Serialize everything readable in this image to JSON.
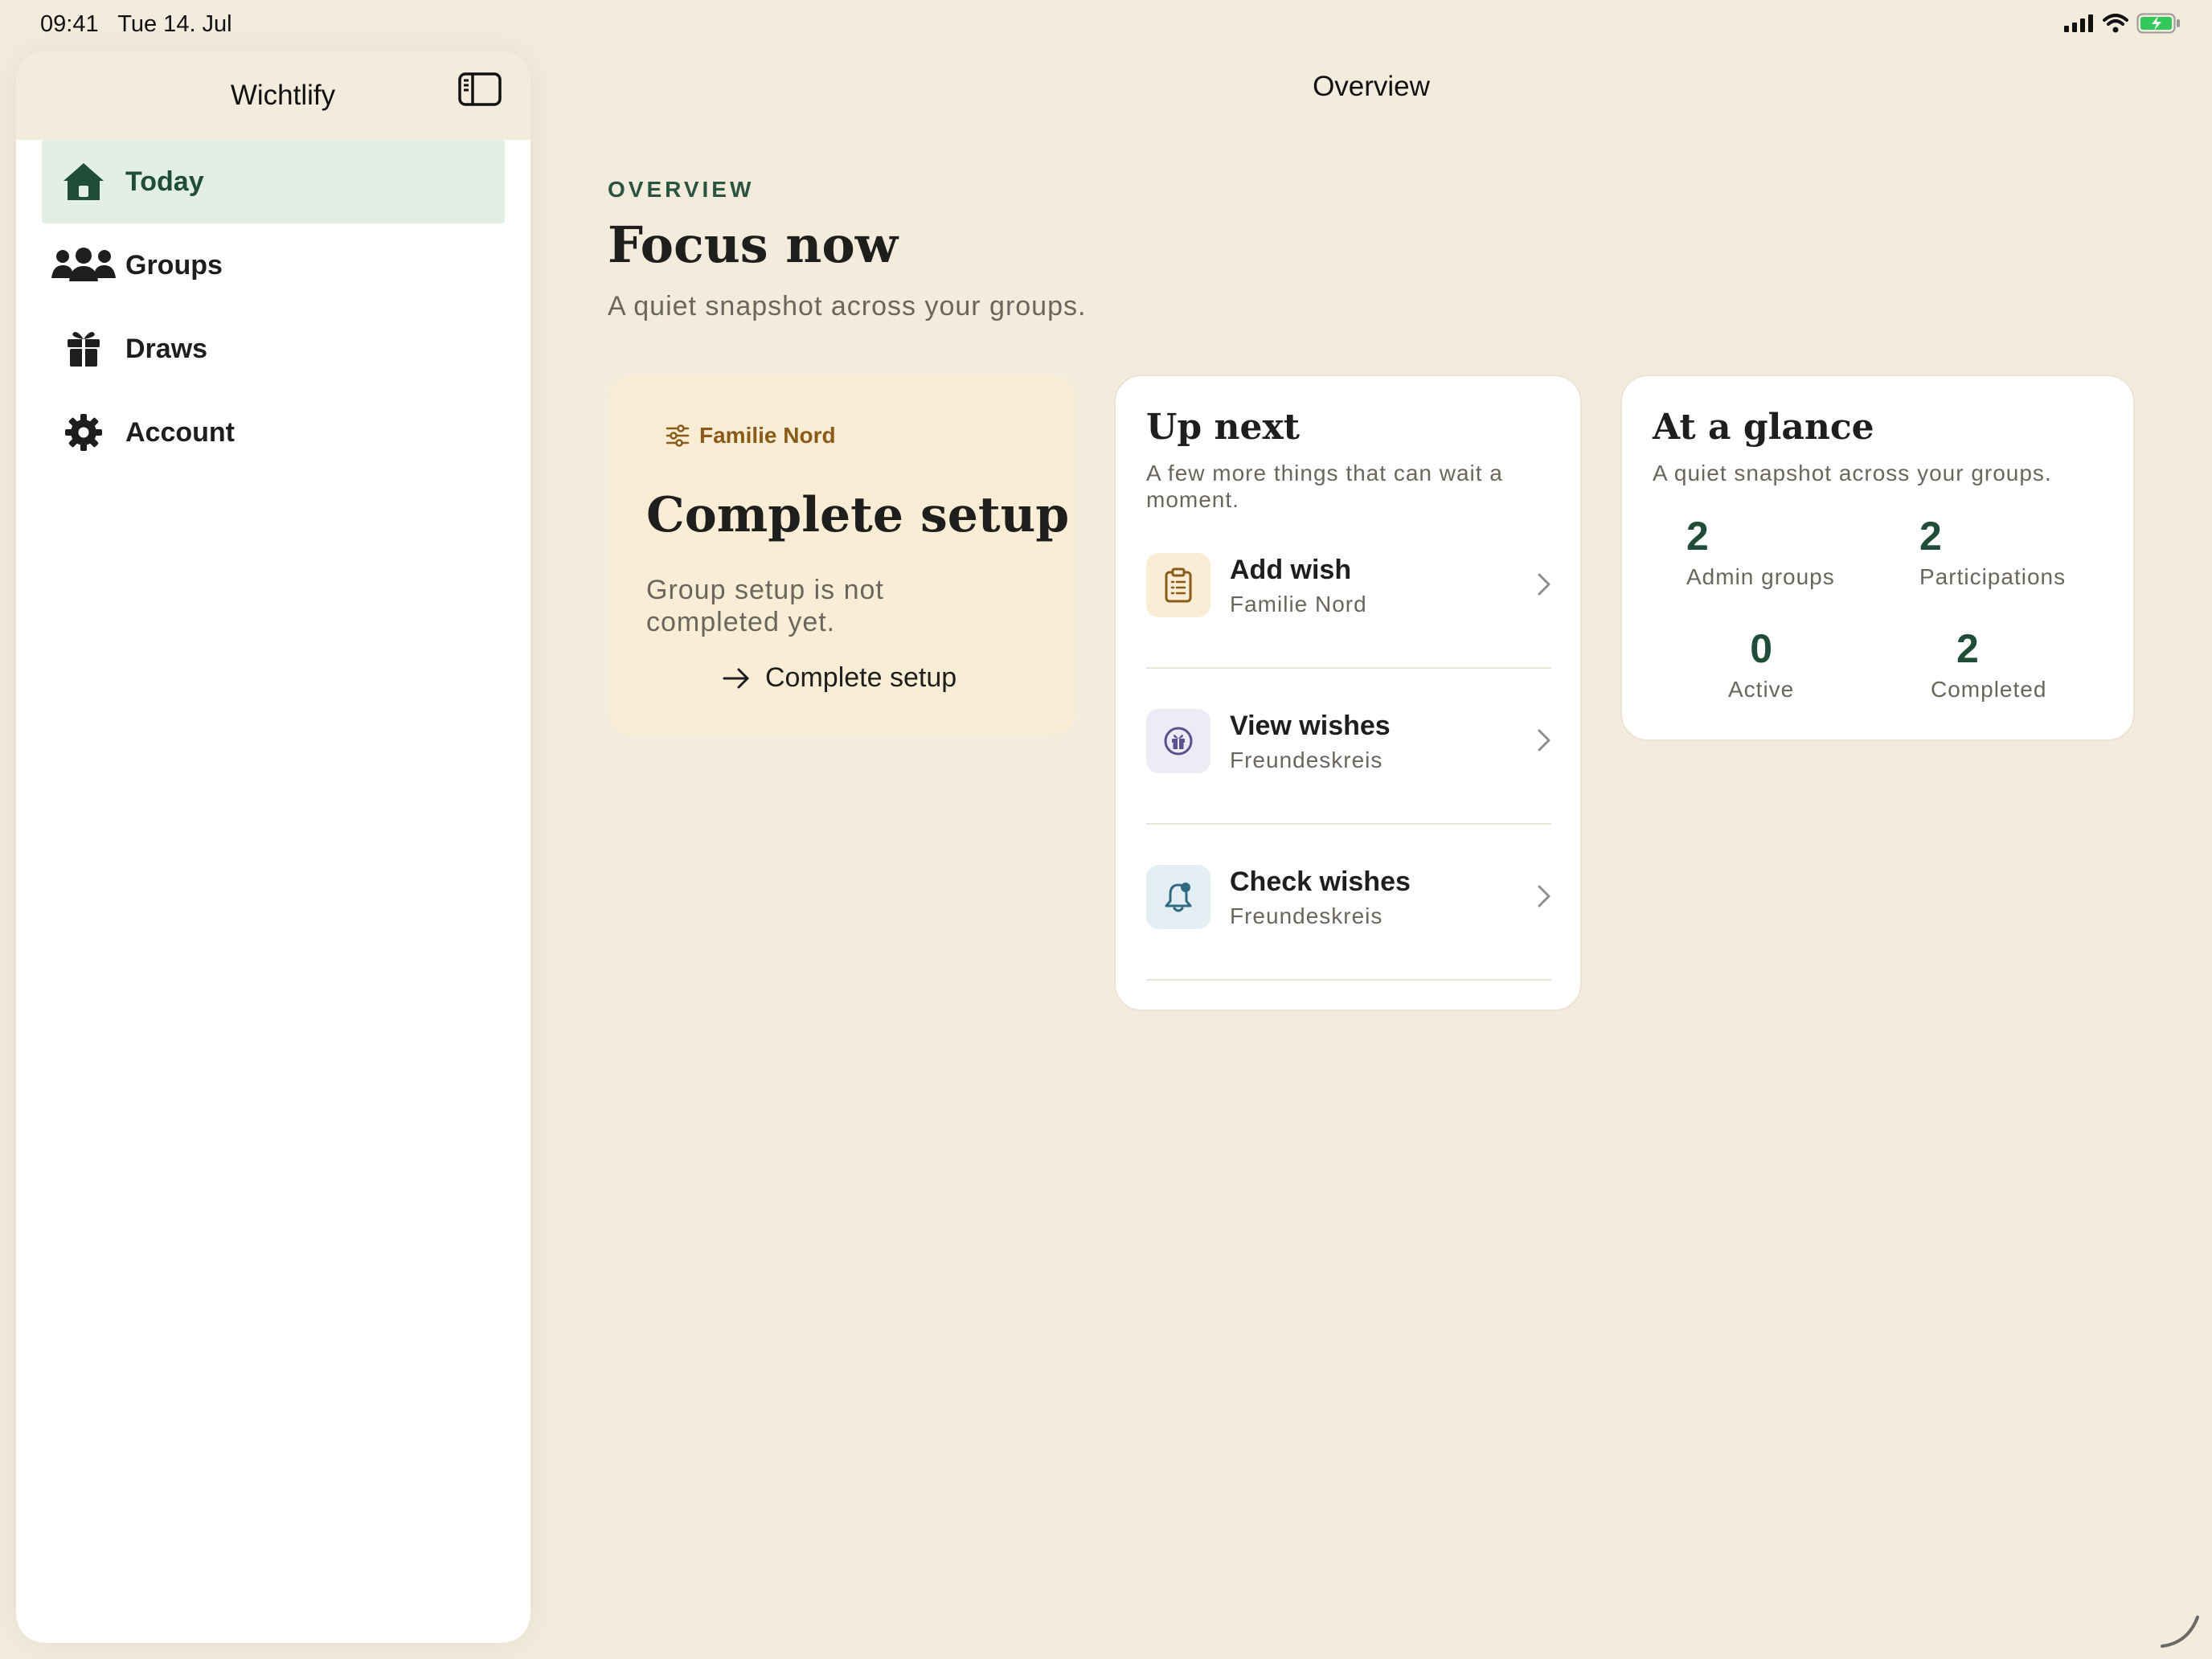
{
  "status_bar": {
    "time": "09:41",
    "date": "Tue 14. Jul",
    "icons": [
      "cellular-signal-icon",
      "wifi-icon",
      "battery-charging-icon"
    ]
  },
  "sidebar": {
    "title": "Wichtlify",
    "toggle_icon": "sidebar-toggle-icon",
    "items": [
      {
        "label": "Today",
        "icon": "house-icon",
        "active": true
      },
      {
        "label": "Groups",
        "icon": "people-icon",
        "active": false
      },
      {
        "label": "Draws",
        "icon": "gift-icon",
        "active": false
      },
      {
        "label": "Account",
        "icon": "gear-icon",
        "active": false
      }
    ]
  },
  "main": {
    "nav_title": "Overview",
    "eyebrow": "OVERVIEW",
    "heading": "Focus now",
    "subheading": "A quiet snapshot across your groups."
  },
  "focus_card": {
    "group": "Familie Nord",
    "title": "Complete setup",
    "description": "Group setup is not completed yet.",
    "action_label": "Complete setup"
  },
  "up_next": {
    "title": "Up next",
    "subtitle": "A few more things that can wait a moment.",
    "items": [
      {
        "title": "Add wish",
        "group": "Familie Nord",
        "icon": "clipboard-icon"
      },
      {
        "title": "View wishes",
        "group": "Freundeskreis",
        "icon": "gift-circle-icon"
      },
      {
        "title": "Check wishes",
        "group": "Freundeskreis",
        "icon": "bell-badge-icon"
      }
    ]
  },
  "glance": {
    "title": "At a glance",
    "subtitle": "A quiet snapshot across your groups.",
    "stats": [
      {
        "value": "2",
        "label": "Admin groups"
      },
      {
        "value": "2",
        "label": "Participations"
      },
      {
        "value": "0",
        "label": "Active"
      },
      {
        "value": "2",
        "label": "Completed"
      }
    ]
  },
  "colors": {
    "background": "#f3ecdd",
    "accent_green": "#1f4d3a",
    "active_nav_bg": "#e3efe4",
    "focus_card_bg": "#faedd5",
    "focus_tag": "#8a5b18"
  }
}
